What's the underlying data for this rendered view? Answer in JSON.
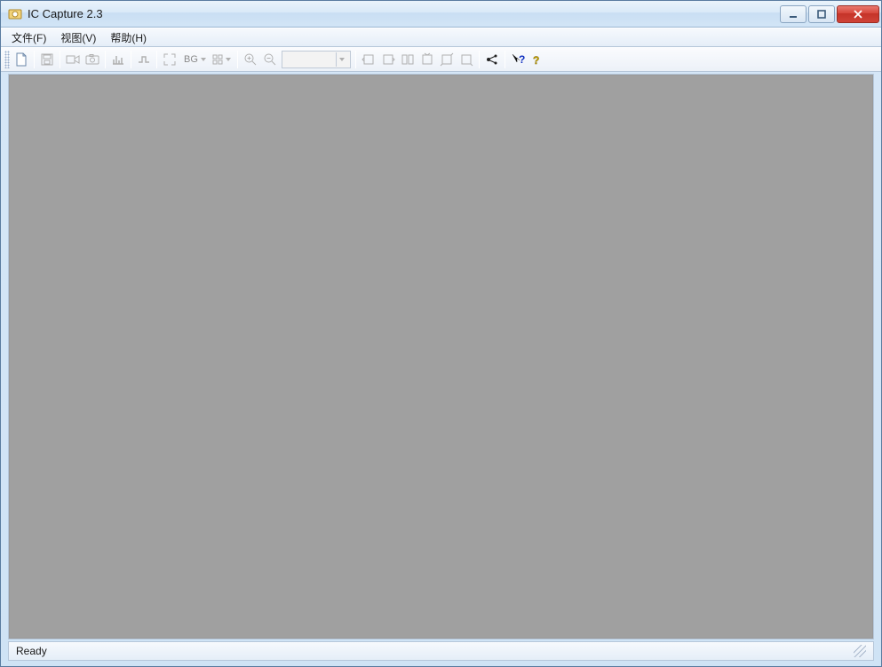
{
  "window": {
    "title": "IC Capture 2.3"
  },
  "menubar": {
    "file": "文件(F)",
    "view": "视图(V)",
    "help": "帮助(H)"
  },
  "toolbar": {
    "bg_label": "BG",
    "combo_value": ""
  },
  "statusbar": {
    "text": "Ready"
  }
}
